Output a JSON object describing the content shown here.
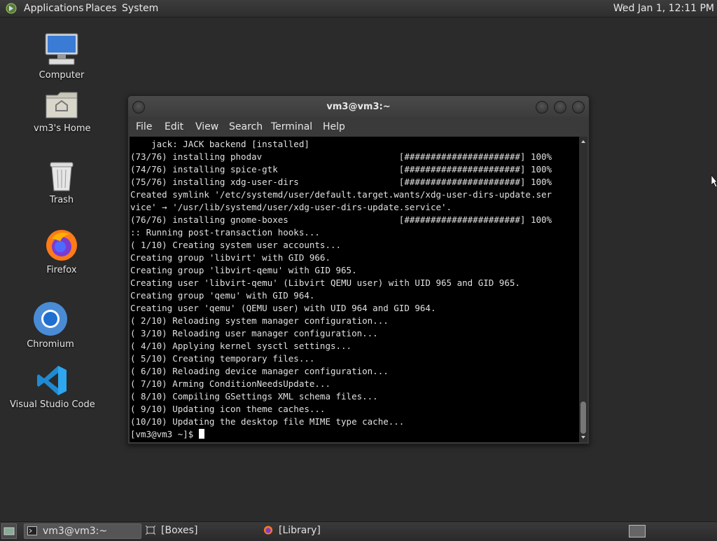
{
  "top_panel": {
    "menus": [
      "Applications",
      "Places",
      "System"
    ],
    "clock": "Wed Jan  1, 12:11 PM"
  },
  "desktop": {
    "icons": [
      {
        "label": "Computer",
        "icon": "computer-icon"
      },
      {
        "label": "vm3's Home",
        "icon": "home-folder-icon"
      },
      {
        "label": "Trash",
        "icon": "trash-icon"
      },
      {
        "label": "Firefox",
        "icon": "firefox-icon"
      },
      {
        "label": "Chromium",
        "icon": "chromium-icon"
      },
      {
        "label": "Visual Studio Code",
        "icon": "vscode-icon"
      }
    ]
  },
  "terminal": {
    "title": "vm3@vm3:~",
    "menu": [
      "File",
      "Edit",
      "View",
      "Search",
      "Terminal",
      "Help"
    ],
    "lines": [
      "    jack: JACK backend [installed]",
      "(73/76) installing phodav                          [######################] 100%",
      "(74/76) installing spice-gtk                       [######################] 100%",
      "(75/76) installing xdg-user-dirs                   [######################] 100%",
      "Created symlink '/etc/systemd/user/default.target.wants/xdg-user-dirs-update.ser",
      "vice' → '/usr/lib/systemd/user/xdg-user-dirs-update.service'.",
      "(76/76) installing gnome-boxes                     [######################] 100%",
      ":: Running post-transaction hooks...",
      "( 1/10) Creating system user accounts...",
      "Creating group 'libvirt' with GID 966.",
      "Creating group 'libvirt-qemu' with GID 965.",
      "Creating user 'libvirt-qemu' (Libvirt QEMU user) with UID 965 and GID 965.",
      "Creating group 'qemu' with GID 964.",
      "Creating user 'qemu' (QEMU user) with UID 964 and GID 964.",
      "( 2/10) Reloading system manager configuration...",
      "( 3/10) Reloading user manager configuration...",
      "( 4/10) Applying kernel sysctl settings...",
      "( 5/10) Creating temporary files...",
      "( 6/10) Reloading device manager configuration...",
      "( 7/10) Arming ConditionNeedsUpdate...",
      "( 8/10) Compiling GSettings XML schema files...",
      "( 9/10) Updating icon theme caches...",
      "(10/10) Updating the desktop file MIME type cache..."
    ],
    "prompt": "[vm3@vm3 ~]$ "
  },
  "taskbar": {
    "tasks": [
      {
        "label": "vm3@vm3:~",
        "icon": "terminal-icon"
      },
      {
        "label": "[Boxes]",
        "icon": "boxes-icon"
      },
      {
        "label": "[Library]",
        "icon": "firefox-icon"
      }
    ]
  },
  "colors": {
    "panel": "#333333",
    "desktop": "#2b2b2b",
    "terminal_bg": "#000000",
    "terminal_fg": "#e0e0e0"
  }
}
